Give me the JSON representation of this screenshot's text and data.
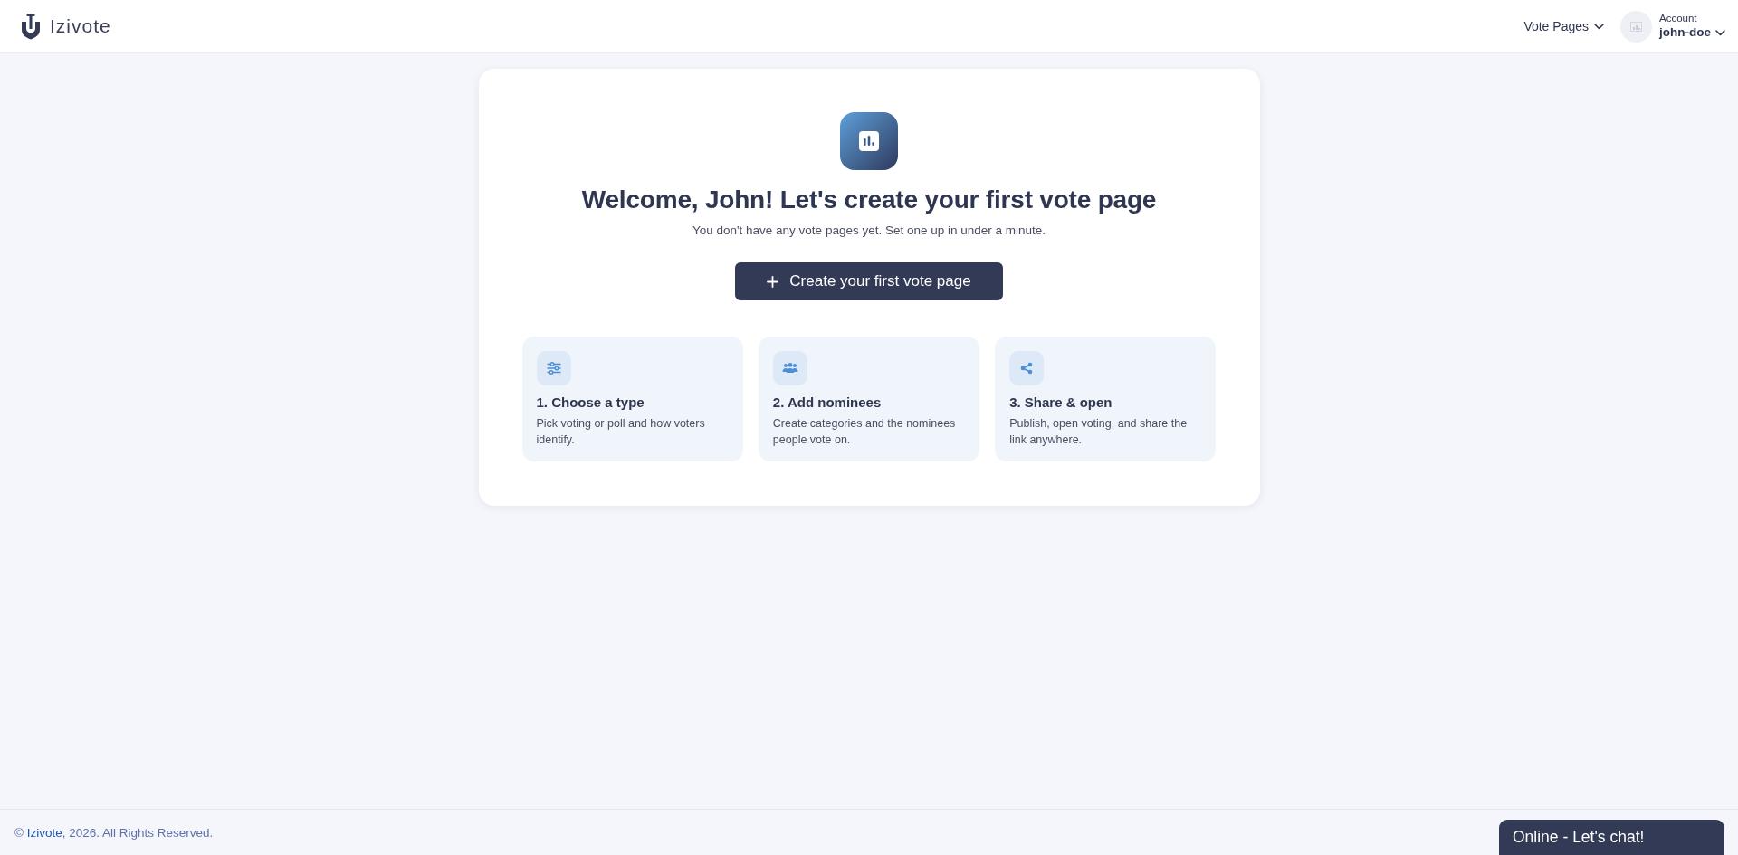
{
  "header": {
    "logo": "Izivote",
    "nav": [
      {
        "label": "Vote Pages"
      }
    ],
    "account": {
      "label": "Account",
      "username": "john-doe"
    }
  },
  "welcome": {
    "title": "Welcome, John! Let's create your first vote page",
    "subtitle": "You don't have any vote pages yet. Set one up in under a minute.",
    "button": "Create your first vote page"
  },
  "steps": [
    {
      "title": "1. Choose a type",
      "description": "Pick voting or poll and how voters identify."
    },
    {
      "title": "2. Add nominees",
      "description": "Create categories and the nominees people vote on."
    },
    {
      "title": "3. Share & open",
      "description": "Publish, open voting, and share the link anywhere."
    }
  ],
  "footer": {
    "symbol": "©",
    "brand": "Izivote",
    "rest": ", 2026. All Rights Reserved."
  },
  "chat_widget": {
    "label": "Online - Let's chat!"
  }
}
